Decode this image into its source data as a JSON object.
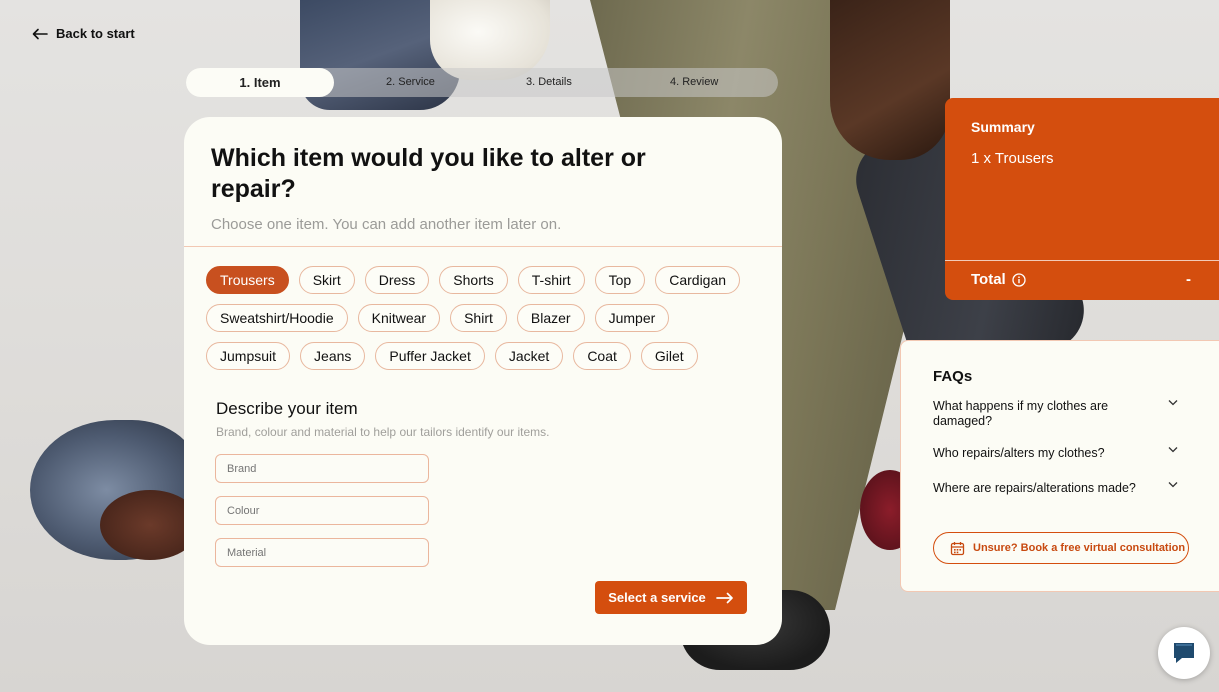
{
  "nav": {
    "back_label": "Back to start"
  },
  "stepper": [
    {
      "label": "1. Item",
      "active": true
    },
    {
      "label": "2. Service",
      "active": false
    },
    {
      "label": "3. Details",
      "active": false
    },
    {
      "label": "4. Review",
      "active": false
    }
  ],
  "card": {
    "title": "Which item would you like to alter or repair?",
    "subtitle": "Choose one item. You can add another item later on.",
    "selected_item": "Trousers",
    "items_rows": [
      [
        "Trousers",
        "Skirt",
        "Dress",
        "Shorts",
        "T-shirt",
        "Top",
        "Cardigan"
      ],
      [
        "Sweatshirt/Hoodie",
        "Knitwear",
        "Shirt",
        "Blazer",
        "Jumper"
      ],
      [
        "Jumpsuit",
        "Jeans",
        "Puffer Jacket",
        "Jacket",
        "Coat",
        "Gilet"
      ]
    ],
    "describe_title": "Describe your item",
    "describe_subtitle": "Brand, colour and material to help our tailors identify our items.",
    "fields": {
      "brand_placeholder": "Brand",
      "colour_placeholder": "Colour",
      "material_placeholder": "Material"
    },
    "cta_label": "Select a service"
  },
  "summary": {
    "title": "Summary",
    "item_line": "1 x Trousers",
    "total_label": "Total",
    "total_value": "-"
  },
  "faq": {
    "title": "FAQs",
    "questions": [
      "What happens if my clothes are damaged?",
      "Who repairs/alters my clothes?",
      "Where are repairs/alterations made?"
    ],
    "consult_label": "Unsure? Book a free virtual consultation"
  },
  "colors": {
    "accent": "#d44e0e",
    "chip_selected": "#c8501f",
    "card_bg": "#fcfcf5",
    "chip_border": "#e8b89f"
  },
  "icons": {
    "back": "arrow-left-icon",
    "cta": "arrow-right-icon",
    "total_info": "info-icon",
    "faq_toggle": "chevron-down-icon",
    "consult": "calendar-icon",
    "chat": "chat-bubble-icon"
  }
}
